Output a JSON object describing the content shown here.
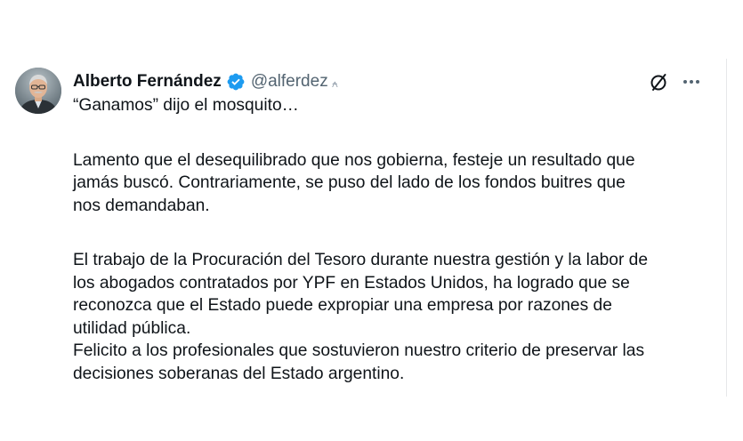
{
  "author": {
    "display_name": "Alberto Fernández",
    "handle": "@alferdez",
    "verified": true,
    "avatar_icon": "profile-photo"
  },
  "actions": {
    "grok_icon": "grok-icon",
    "more_icon": "more-options-icon",
    "handle_mark": "⍲"
  },
  "tweet": {
    "line1": "“Ganamos” dijo el mosquito…",
    "p2_l1": "Lamento que el desequilibrado que nos gobierna, festeje un resultado que",
    "p2_l2": "jamás buscó. Contrariamente, se puso del lado de los fondos buitres que",
    "p2_l3": "nos demandaban.",
    "p3_l1": "El trabajo de la Procuración del Tesoro durante nuestra gestión y la labor de",
    "p3_l2": "los abogados contratados por YPF en Estados Unidos, ha logrado que se",
    "p3_l3": "reconozca que el Estado puede expropiar una empresa por razones de",
    "p3_l4": "utilidad pública.",
    "p3_l5": "Felicito a los profesionales que sostuvieron nuestro criterio de preservar las",
    "p3_l6": "decisiones soberanas del Estado argentino."
  },
  "colors": {
    "verified": "#1d9bf0",
    "text": "#0f1419",
    "secondary": "#536471"
  }
}
